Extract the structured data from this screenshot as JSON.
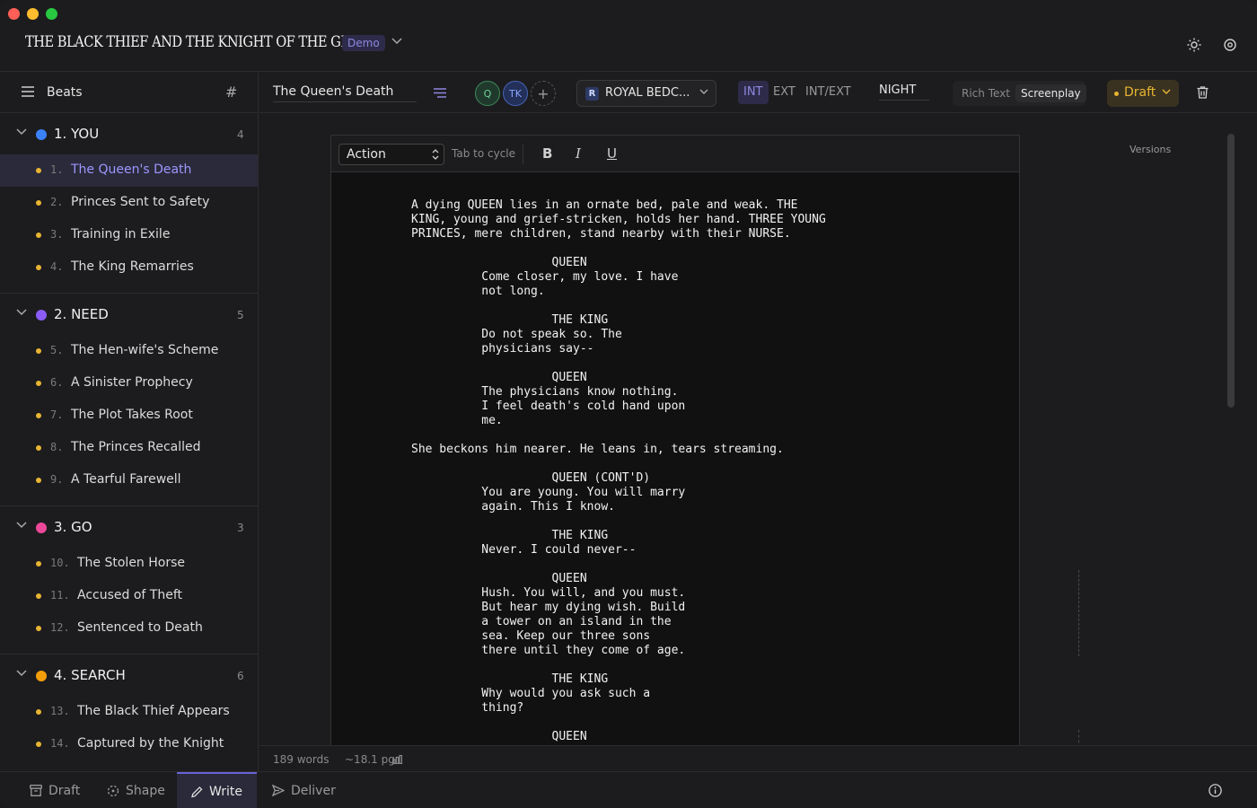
{
  "window": {
    "title": "THE BLACK THIEF AND THE KNIGHT OF THE GLEN",
    "badge": "Demo",
    "icons": [
      "chevron-down-icon",
      "sun-icon",
      "settings-icon"
    ]
  },
  "sidebar": {
    "header_label": "Beats",
    "hash_symbol": "#",
    "acts": [
      {
        "name": "1. YOU",
        "count": "4",
        "color": "#3b82f6",
        "beats": [
          {
            "num": "1.",
            "title": "The Queen's Death",
            "active": true
          },
          {
            "num": "2.",
            "title": "Princes Sent to Safety"
          },
          {
            "num": "3.",
            "title": "Training in Exile"
          },
          {
            "num": "4.",
            "title": "The King Remarries"
          }
        ]
      },
      {
        "name": "2. NEED",
        "count": "5",
        "color": "#8b5cf6",
        "beats": [
          {
            "num": "5.",
            "title": "The Hen-wife's Scheme"
          },
          {
            "num": "6.",
            "title": "A Sinister Prophecy"
          },
          {
            "num": "7.",
            "title": "The Plot Takes Root"
          },
          {
            "num": "8.",
            "title": "The Princes Recalled"
          },
          {
            "num": "9.",
            "title": "A Tearful Farewell"
          }
        ]
      },
      {
        "name": "3. GO",
        "count": "3",
        "color": "#ec4899",
        "beats": [
          {
            "num": "10.",
            "title": "The Stolen Horse"
          },
          {
            "num": "11.",
            "title": "Accused of Theft"
          },
          {
            "num": "12.",
            "title": "Sentenced to Death"
          }
        ]
      },
      {
        "name": "4. SEARCH",
        "count": "6",
        "color": "#f59e0b",
        "beats": [
          {
            "num": "13.",
            "title": "The Black Thief Appears"
          },
          {
            "num": "14.",
            "title": "Captured by the Knight"
          }
        ]
      }
    ]
  },
  "toolbar": {
    "scene_title": "The Queen's Death",
    "avatars": [
      "Q",
      "TK"
    ],
    "add_symbol": "+",
    "location_initial": "R",
    "location": "ROYAL BEDC...",
    "int_ext": [
      "INT",
      "EXT",
      "INT/EXT"
    ],
    "int_ext_selected": "INT",
    "time_of_day": "NIGHT",
    "modes": [
      "Rich Text",
      "Screenplay"
    ],
    "mode_selected": "Screenplay",
    "status": "Draft"
  },
  "editor": {
    "element_type": "Action",
    "hint": "Tab to cycle",
    "format_buttons": [
      "B",
      "I",
      "U"
    ],
    "script_text": "A dying QUEEN lies in an ornate bed, pale and weak. THE\nKING, young and grief-stricken, holds her hand. THREE YOUNG\nPRINCES, mere children, stand nearby with their NURSE.\n\n                    QUEEN\n          Come closer, my love. I have\n          not long.\n\n                    THE KING\n          Do not speak so. The\n          physicians say--\n\n                    QUEEN\n          The physicians know nothing.\n          I feel death's cold hand upon\n          me.\n\nShe beckons him nearer. He leans in, tears streaming.\n\n                    QUEEN (CONT'D)\n          You are young. You will marry\n          again. This I know.\n\n                    THE KING\n          Never. I could never--\n\n                    QUEEN\n          Hush. You will, and you must.\n          But hear my dying wish. Build\n          a tower on an island in the\n          sea. Keep our three sons\n          there until they come of age.\n\n                    THE KING\n          Why would you ask such a\n          thing?\n\n                    QUEEN",
    "versions_label": "Versions"
  },
  "statusbar": {
    "words": "189 words",
    "pages": "~18.1 pg"
  },
  "bottom_tabs": [
    {
      "label": "Draft",
      "icon": "archive-icon"
    },
    {
      "label": "Shape",
      "icon": "shape-icon"
    },
    {
      "label": "Write",
      "icon": "pencil-icon",
      "active": true
    },
    {
      "label": "Deliver",
      "icon": "send-icon"
    }
  ]
}
